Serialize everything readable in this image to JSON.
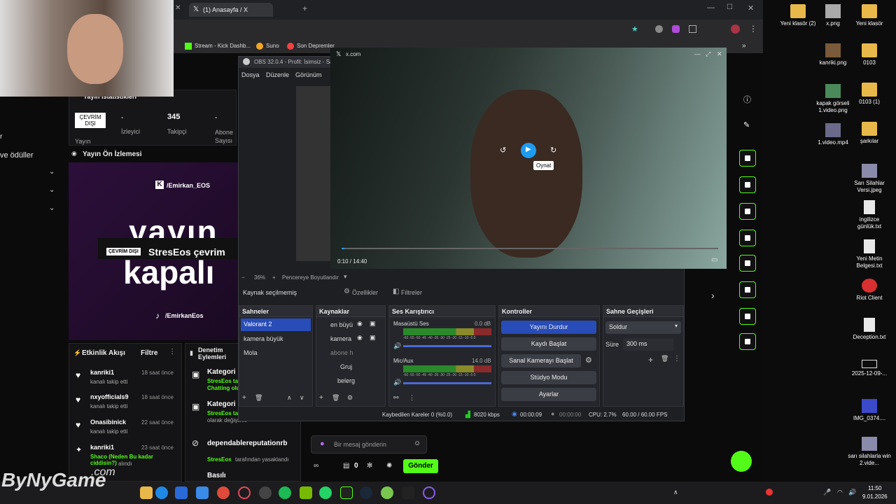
{
  "browser": {
    "tab_title": "(1) Anasayfa / X",
    "bookmarks": [
      "Stream - Kick Dashb...",
      "Suno",
      "Son Depremler"
    ]
  },
  "kick": {
    "stream_stats_title": "Yayın İstatistikleri",
    "status_badge": "ÇEVRİM DIŞI",
    "status_caption": "Yayın",
    "viewers_value": "-",
    "viewers_label": "İzleyici",
    "followers_value": "345",
    "followers_label": "Takipçi",
    "subs_value": "-",
    "subs_label": "Abone Sayısı",
    "left_menu_1": "r",
    "left_menu_2": "ve ödüller",
    "preview_title": "Yayın Ön İzlemesi",
    "preview_user": "/Emirkan_EOS",
    "preview_big_1": "yayın",
    "preview_big_2": "kapalı",
    "preview_tiktok": "/EmirkanEos",
    "offline_badge": "ÇEVRİM DIŞI",
    "offline_text": "StresEos çevrim",
    "activity_title": "Etkinlik Akışı",
    "activity_filter": "Filtre",
    "activity": [
      {
        "name": "kanriki1",
        "time": "18 saat önce",
        "desc": "kanalı takip etti"
      },
      {
        "name": "nxyofficials9",
        "time": "18 saat önce",
        "desc": "kanalı takip etti"
      },
      {
        "name": "Onasibinick",
        "time": "22 saat önce",
        "desc": "kanalı takip etti"
      },
      {
        "name": "kanriki1",
        "time": "23 saat önce",
        "desc": "Shaco (Neden Bu kadar ciddisin?)",
        "desc2": "alındı"
      }
    ],
    "audit_title": "Denetim Eylemleri",
    "audit": [
      {
        "title": "Kategori",
        "line1": "StresEos ta",
        "line2": "Chatting olu"
      },
      {
        "title": "Kategori",
        "line1": "StresEos ta",
        "line2": "olarak değiştirilir"
      },
      {
        "title": "dependablereputationrb",
        "line1": "StresEos",
        "line2": "tarafından yasaklandı"
      },
      {
        "title": "Basılı",
        "line1": "",
        "line2": ""
      }
    ],
    "chat_placeholder": "Bir mesaj gönderin",
    "chat_count": "0",
    "send_label": "Gönder"
  },
  "obs": {
    "title": "OBS 32.0.4 - Profil: İsimsiz - Sahn",
    "menu": [
      "Dosya",
      "Düzenle",
      "Görünüm"
    ],
    "zoom": "36%",
    "zoom_mode": "Pencereye Boyutlandır",
    "source_status": "Kaynak seçilmemiş",
    "properties": "Özellikler",
    "filters": "Filtreler",
    "scenes_title": "Sahneler",
    "scenes": [
      "Valorant 2",
      "kamera büyük",
      "Mola"
    ],
    "sources_title": "Kaynaklar",
    "sources": [
      "en büyü",
      "kamera",
      "abone h",
      "Gruj",
      "belerg"
    ],
    "mixer_title": "Ses Karıştırıcı",
    "mixer": [
      {
        "name": "Masaüstü Ses",
        "db": "0.0 dB"
      },
      {
        "name": "Mic/Aux",
        "db": "14.0 dB"
      }
    ],
    "meter_scale": "-60 -55 -50 -45 -40 -35 -30 -25 -20 -15 -10 -5 0",
    "controls_title": "Kontroller",
    "controls": [
      "Yayını Durdur",
      "Kaydı Başlat",
      "Sanal Kamerayı Başlat",
      "Stüdyo Modu",
      "Ayarlar"
    ],
    "transitions_title": "Sahne Geçişleri",
    "transition": "Soldur",
    "duration_label": "Süre",
    "duration": "300 ms",
    "statusbar": {
      "dropped": "Kaybedilen Kareler 0 (%0.0)",
      "bitrate": "8020 kbps",
      "stream_time": "00:00:09",
      "rec_time": "00:00:00",
      "cpu": "CPU: 2.7%",
      "fps": "60.00 / 60.00 FPS"
    }
  },
  "xvideo": {
    "title": "x.com",
    "tooltip": "Oynat",
    "time": "0:10 / 14:40"
  },
  "desktop": [
    {
      "label": "Yeni klasör (2)",
      "type": "folder"
    },
    {
      "label": "x.png",
      "type": "image"
    },
    {
      "label": "Yeni klasör",
      "type": "folder"
    },
    {
      "label": "kanriki.png",
      "type": "image"
    },
    {
      "label": "0103",
      "type": "folder"
    },
    {
      "label": "kapak görseli 1.video.png",
      "type": "image"
    },
    {
      "label": "0103 (1)",
      "type": "folder"
    },
    {
      "label": "1.video.mp4",
      "type": "video"
    },
    {
      "label": "şarkılar",
      "type": "folder"
    },
    {
      "label": "Sarı Silahlar Versi.jpeg",
      "type": "image"
    },
    {
      "label": "ingilizce günlük.txt",
      "type": "file"
    },
    {
      "label": "Yeni Metin Belgesi.txt",
      "type": "file"
    },
    {
      "label": "Riot Client",
      "type": "app"
    },
    {
      "label": "Deception.txt",
      "type": "file"
    },
    {
      "label": "2025-12-09-...",
      "type": "file"
    },
    {
      "label": "IMG_0374....",
      "type": "image"
    },
    {
      "label": "sarı silahlarla win 2.vide...",
      "type": "image"
    }
  ],
  "watermark": "ByNyGame",
  "watermark2": ".com",
  "clock": {
    "time": "11:50",
    "date": "9.01.2026"
  },
  "colors": {
    "kick_green": "#53fc18",
    "obs_blue": "#284cb8"
  }
}
